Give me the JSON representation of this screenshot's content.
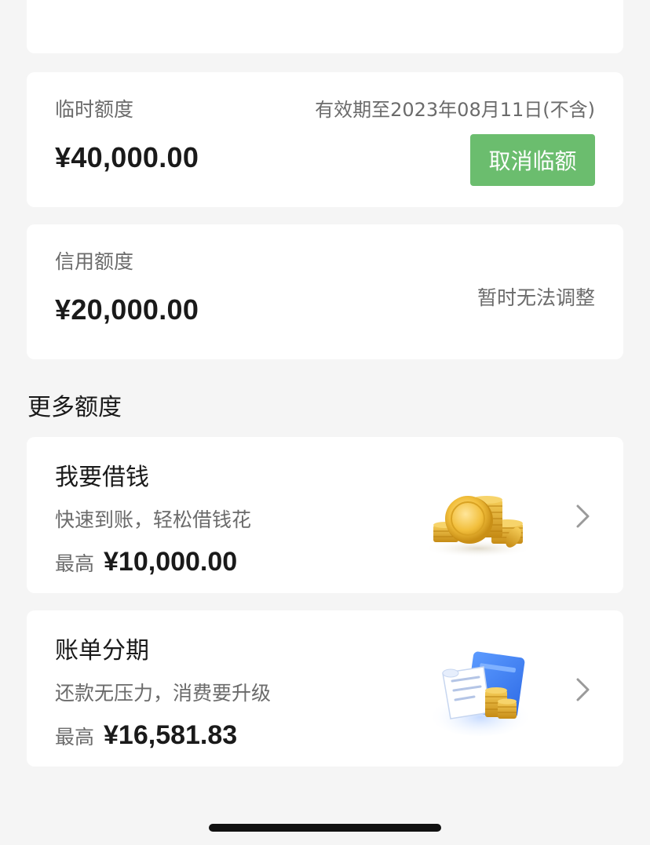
{
  "temporary_limit": {
    "label": "临时额度",
    "validity": "有效期至2023年08月11日(不含)",
    "amount": "¥40,000.00",
    "cancel_button": "取消临额"
  },
  "credit_limit": {
    "label": "信用额度",
    "amount": "¥20,000.00",
    "note": "暂时无法调整"
  },
  "more_limits": {
    "title": "更多额度",
    "items": [
      {
        "title": "我要借钱",
        "subtitle": "快速到账，轻松借钱花",
        "max_label": "最高",
        "max_amount": "¥10,000.00",
        "icon": "gold-coins-icon"
      },
      {
        "title": "账单分期",
        "subtitle": "还款无压力，消费要升级",
        "max_label": "最高",
        "max_amount": "¥16,581.83",
        "icon": "card-bill-coins-icon"
      }
    ]
  },
  "colors": {
    "background": "#f5f5f5",
    "card": "#ffffff",
    "accent_green": "#6bbd6e",
    "text_primary": "#1a1a1a",
    "text_secondary": "#6b6b6b"
  }
}
